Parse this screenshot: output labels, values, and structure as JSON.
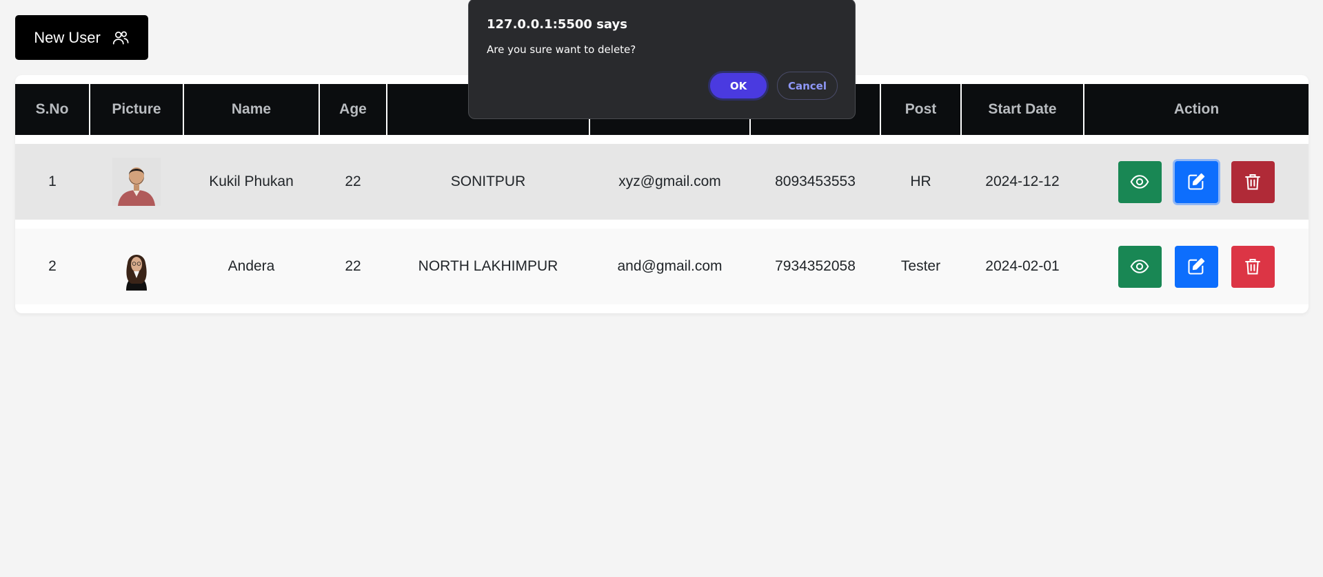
{
  "toolbar": {
    "new_user_label": "New User"
  },
  "table": {
    "headers": [
      "S.No",
      "Picture",
      "Name",
      "Age",
      "",
      "",
      "",
      "Post",
      "Start Date",
      "Action"
    ],
    "rows": [
      {
        "sno": "1",
        "name": "Kukil Phukan",
        "age": "22",
        "city": "SONITPUR",
        "email": "xyz@gmail.com",
        "phone": "8093453553",
        "post": "HR",
        "start_date": "2024-12-12"
      },
      {
        "sno": "2",
        "name": "Andera",
        "age": "22",
        "city": "NORTH LAKHIMPUR",
        "email": "and@gmail.com",
        "phone": "7934352058",
        "post": "Tester",
        "start_date": "2024-02-01"
      }
    ]
  },
  "dialog": {
    "title": "127.0.0.1:5500 says",
    "message": "Are you sure want to delete?",
    "ok_label": "OK",
    "cancel_label": "Cancel"
  },
  "colors": {
    "view": "#198754",
    "edit": "#0d6efd",
    "delete": "#dc3545",
    "header_bg": "#0b0d0f",
    "dialog_ok": "#4a3ae0"
  },
  "icons": {
    "new_user": "users-icon",
    "view": "eye-icon",
    "edit": "edit-icon",
    "delete": "trash-icon"
  }
}
